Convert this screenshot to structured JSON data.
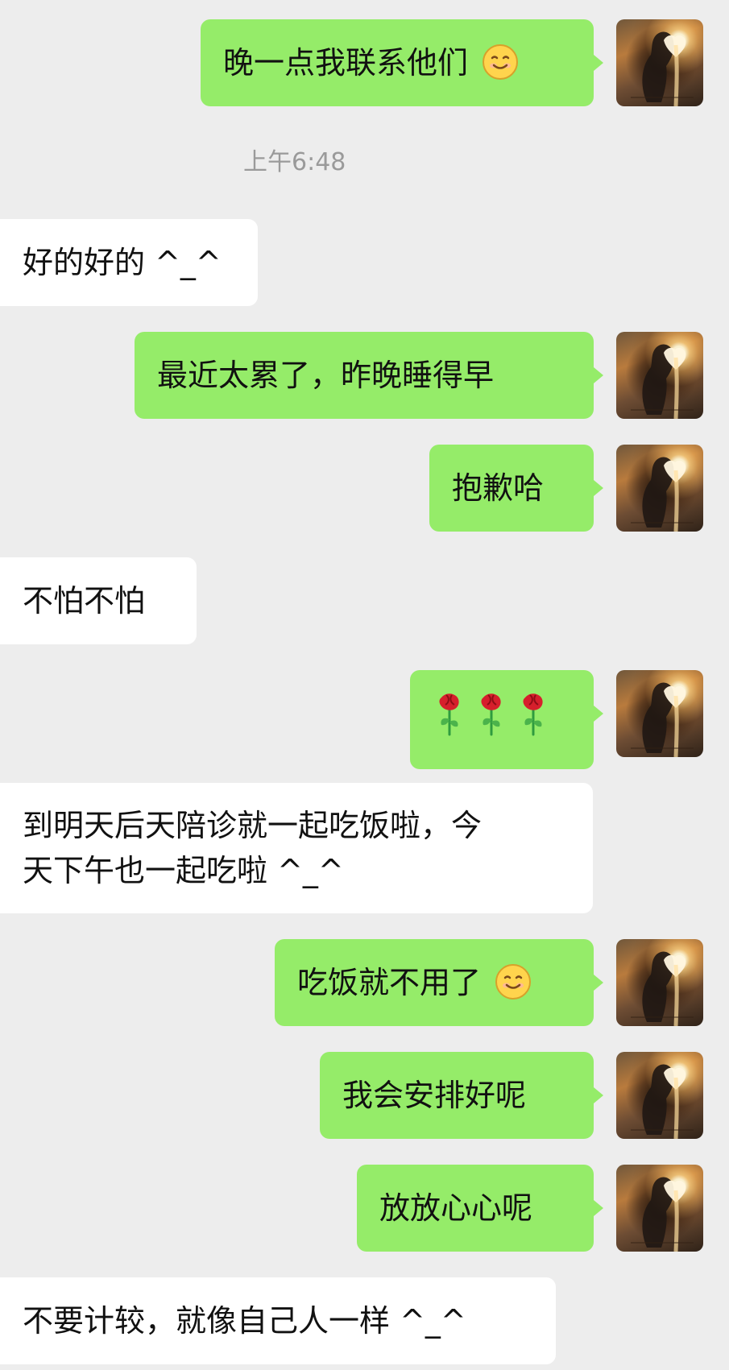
{
  "chat": {
    "timestamp": "上午6:48",
    "messages": [
      {
        "text": "晚一点我联系他们",
        "emoji": "smiling-face-icon"
      },
      {
        "text": "好的好的 ^_^"
      },
      {
        "text": "最近太累了，昨晚睡得早"
      },
      {
        "text": "抱歉哈"
      },
      {
        "text": "不怕不怕"
      },
      {
        "icons": [
          "rose-icon",
          "rose-icon",
          "rose-icon"
        ]
      },
      {
        "line1": "到明天后天陪诊就一起吃饭啦，今",
        "line2": "天下午也一起吃啦 ^_^"
      },
      {
        "text": "吃饭就不用了",
        "emoji": "smiling-face-icon"
      },
      {
        "text": "我会安排好呢"
      },
      {
        "text": "放放心心呢"
      },
      {
        "text": "不要计较，就像自己人一样 ^_^"
      }
    ]
  }
}
